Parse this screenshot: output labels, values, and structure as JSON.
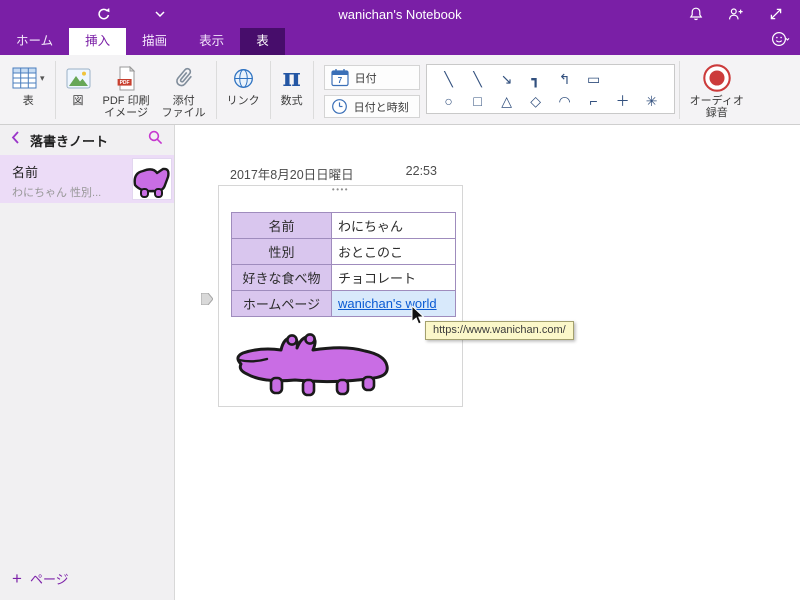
{
  "titlebar": {
    "title": "wanichan's Notebook"
  },
  "tabs": {
    "home": "ホーム",
    "insert": "挿入",
    "draw": "描画",
    "view": "表示",
    "table": "表"
  },
  "ribbon": {
    "table": "表",
    "picture": "図",
    "pdf_line1": "PDF 印刷",
    "pdf_line2": "イメージ",
    "attach_line1": "添付",
    "attach_line2": "ファイル",
    "link": "リンク",
    "equation": "数式",
    "equation_symbol": "π",
    "date": "日付",
    "datetime": "日付と時刻",
    "calendar_day": "7",
    "audio_line1": "オーディオ",
    "audio_line2": "録音",
    "shapes_row1": [
      "╲",
      "╲",
      "↘",
      "┓",
      "↰",
      "▭"
    ],
    "shapes_row2": [
      "○",
      "□",
      "△",
      "◇",
      "◠",
      "⌐",
      "＋",
      "✳"
    ]
  },
  "icons": {
    "dropdown": "▾"
  },
  "sidebar": {
    "notebook": "落書きノート",
    "page_title": "名前",
    "page_preview": "わにちゃん 性別...",
    "add_plus": "+",
    "add_page": "ページ"
  },
  "page": {
    "date": "2017年8月20日日曜日",
    "time": "22:53",
    "handle_dots": "••••",
    "table": {
      "rows": [
        {
          "label": "名前",
          "value": "わにちゃん"
        },
        {
          "label": "性別",
          "value": "おとこのこ"
        },
        {
          "label": "好きな食べ物",
          "value": "チョコレート"
        },
        {
          "label": "ホームページ",
          "value": "wanichan's world"
        }
      ]
    },
    "tooltip": "https://www.wanichan.com/"
  },
  "colors": {
    "brand": "#7a1fa6",
    "contextual_tab": "#470d6b",
    "link": "#0b5bd3",
    "record_red": "#cc3b3b",
    "doodle_fill": "#c96de4"
  }
}
